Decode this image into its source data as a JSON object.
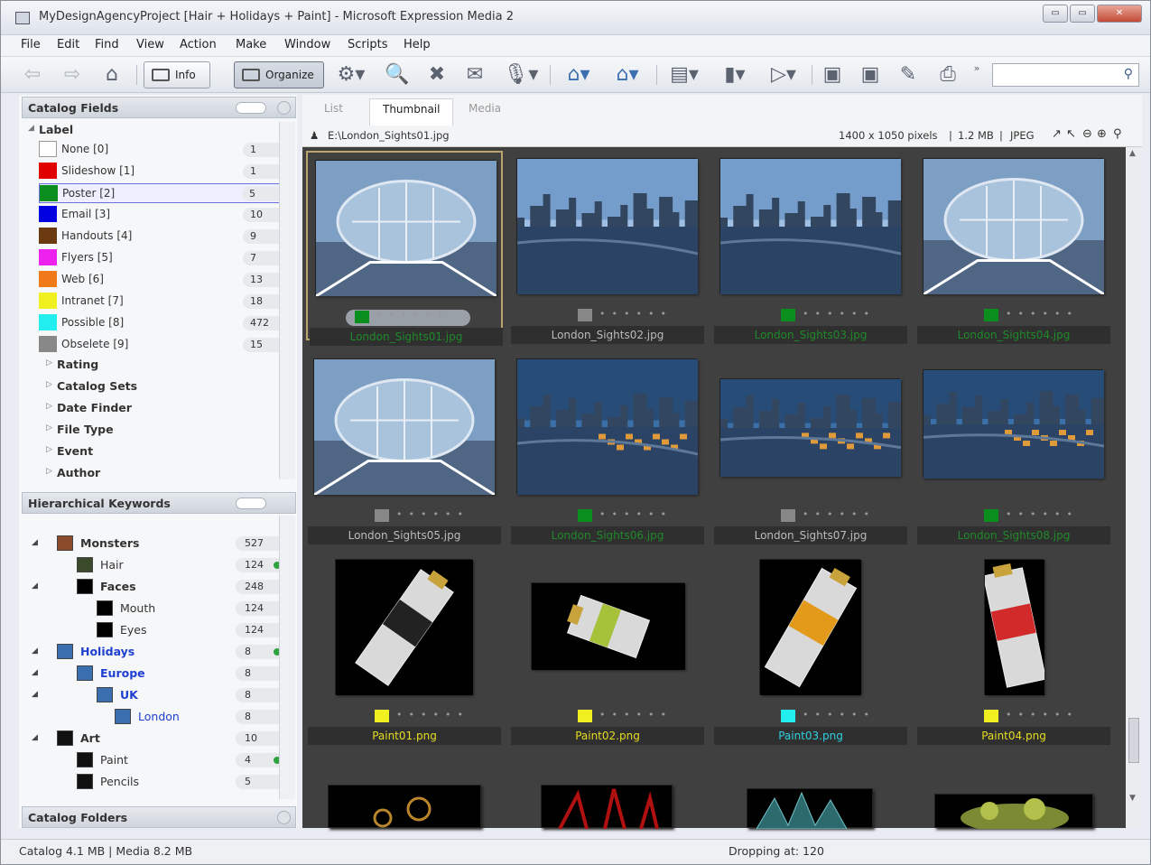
{
  "window": {
    "title": "MyDesignAgencyProject [Hair + Holidays + Paint] - Microsoft Expression Media 2",
    "min": "▭",
    "max": "▭",
    "close": "✕"
  },
  "menu": [
    "File",
    "Edit",
    "Find",
    "View",
    "Action",
    "Make",
    "Window",
    "Scripts",
    "Help"
  ],
  "toolbar": {
    "info_label": "Info",
    "organize_label": "Organize",
    "more": "»"
  },
  "catalog_fields": {
    "title": "Catalog Fields",
    "label_section": "Label",
    "labels": [
      {
        "name": "None [0]",
        "count": "1",
        "color": "#ffffff"
      },
      {
        "name": "Slideshow [1]",
        "count": "1",
        "color": "#e00000"
      },
      {
        "name": "Poster [2]",
        "count": "5",
        "color": "#0a8f1e"
      },
      {
        "name": "Email [3]",
        "count": "10",
        "color": "#0000e0"
      },
      {
        "name": "Handouts [4]",
        "count": "9",
        "color": "#6b3a10"
      },
      {
        "name": "Flyers [5]",
        "count": "7",
        "color": "#ee22ee"
      },
      {
        "name": "Web [6]",
        "count": "13",
        "color": "#f07a1a"
      },
      {
        "name": "Intranet [7]",
        "count": "18",
        "color": "#f0f020"
      },
      {
        "name": "Possible [8]",
        "count": "472",
        "color": "#22eef0"
      },
      {
        "name": "Obselete [9]",
        "count": "15",
        "color": "#888888"
      }
    ],
    "sections": [
      "Rating",
      "Catalog Sets",
      "Date Finder",
      "File Type",
      "Event",
      "Author"
    ]
  },
  "keywords": {
    "title": "Hierarchical Keywords",
    "items": [
      {
        "name": "Monsters",
        "count": "527",
        "bold": true,
        "dot": false
      },
      {
        "name": "Hair",
        "count": "124",
        "bold": false,
        "dot": true
      },
      {
        "name": "Faces",
        "count": "248",
        "bold": true,
        "dot": false
      },
      {
        "name": "Mouth",
        "count": "124",
        "bold": false,
        "dot": false
      },
      {
        "name": "Eyes",
        "count": "124",
        "bold": false,
        "dot": false
      },
      {
        "name": "Holidays",
        "count": "8",
        "bold": true,
        "dot": true
      },
      {
        "name": "Europe",
        "count": "8",
        "bold": true,
        "dot": false
      },
      {
        "name": "UK",
        "count": "8",
        "bold": true,
        "dot": false
      },
      {
        "name": "London",
        "count": "8",
        "bold": false,
        "dot": false
      },
      {
        "name": "Art",
        "count": "10",
        "bold": true,
        "dot": false
      },
      {
        "name": "Paint",
        "count": "4",
        "bold": false,
        "dot": true
      },
      {
        "name": "Pencils",
        "count": "5",
        "bold": false,
        "dot": false
      }
    ]
  },
  "catalog_folders": {
    "title": "Catalog Folders"
  },
  "tabs": [
    "List",
    "Thumbnail",
    "Media"
  ],
  "info": {
    "path": "E:\\London_Sights01.jpg",
    "dims": "1400 x 1050 pixels",
    "size": "1.2 MB",
    "type": "JPEG"
  },
  "thumbs": [
    {
      "name": "London_Sights01.jpg",
      "chip": "#0a8f1e",
      "cls": "green"
    },
    {
      "name": "London_Sights02.jpg",
      "chip": "#888888",
      "cls": ""
    },
    {
      "name": "London_Sights03.jpg",
      "chip": "#0a8f1e",
      "cls": "green"
    },
    {
      "name": "London_Sights04.jpg",
      "chip": "#0a8f1e",
      "cls": "green"
    },
    {
      "name": "London_Sights05.jpg",
      "chip": "#888888",
      "cls": ""
    },
    {
      "name": "London_Sights06.jpg",
      "chip": "#0a8f1e",
      "cls": "green"
    },
    {
      "name": "London_Sights07.jpg",
      "chip": "#888888",
      "cls": ""
    },
    {
      "name": "London_Sights08.jpg",
      "chip": "#0a8f1e",
      "cls": "green"
    },
    {
      "name": "Paint01.png",
      "chip": "#f0f020",
      "cls": "yellow"
    },
    {
      "name": "Paint02.png",
      "chip": "#f0f020",
      "cls": "yellow"
    },
    {
      "name": "Paint03.png",
      "chip": "#22eef0",
      "cls": "cyan"
    },
    {
      "name": "Paint04.png",
      "chip": "#f0f020",
      "cls": "yellow"
    }
  ],
  "status": {
    "left": "Catalog 4.1 MB | Media 8.2 MB",
    "right": "Dropping at: 120"
  }
}
